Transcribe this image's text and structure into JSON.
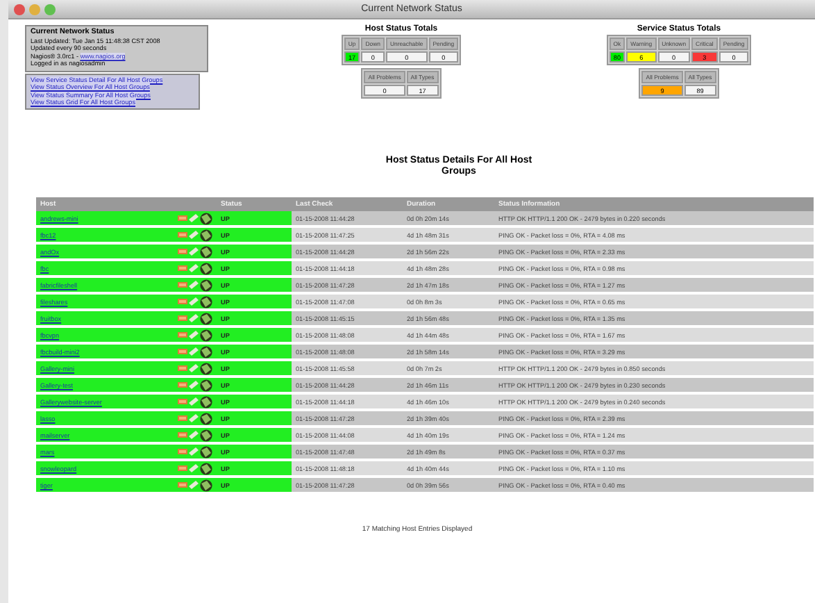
{
  "window": {
    "title": "Current Network Status"
  },
  "info": {
    "title": "Current Network Status",
    "lines": [
      "Last Updated: Tue Jan 15 11:48:38 CST 2008",
      "Updated every 90 seconds",
      "Logged in as nagiosadmin"
    ],
    "version": "Nagios® 3.0rc1 -",
    "version_link": "www.nagios.org"
  },
  "links": [
    "View Service Status Detail For All Host Groups",
    "View Status Overview For All Host Groups",
    "View Status Summary For All Host Groups",
    "View Status Grid For All Host Groups"
  ],
  "host_totals": {
    "title": "Host Status Totals",
    "main": [
      {
        "label": "Up",
        "value": "17",
        "color": "#00ee00"
      },
      {
        "label": "Down",
        "value": "0"
      },
      {
        "label": "Unreachable",
        "value": "0"
      },
      {
        "label": "Pending",
        "value": "0"
      }
    ],
    "summary": [
      {
        "label": "All Problems",
        "value": "0"
      },
      {
        "label": "All Types",
        "value": "17"
      }
    ]
  },
  "service_totals": {
    "title": "Service Status Totals",
    "main": [
      {
        "label": "Ok",
        "value": "80",
        "color": "#00ee00"
      },
      {
        "label": "Warning",
        "value": "6",
        "color": "#ffff00"
      },
      {
        "label": "Unknown",
        "value": "0"
      },
      {
        "label": "Critical",
        "value": "3",
        "color": "#f83838"
      },
      {
        "label": "Pending",
        "value": "0"
      }
    ],
    "summary": [
      {
        "label": "All Problems",
        "value": "9",
        "color": "#ffa500"
      },
      {
        "label": "All Types",
        "value": "89"
      }
    ]
  },
  "heading": "Host Status Details For All Host Groups",
  "table": {
    "columns": [
      "Host",
      "Status",
      "Last Check",
      "Duration",
      "Status Information"
    ],
    "rows": [
      {
        "host": "andrews-mini",
        "status": "UP",
        "last_check": "01-15-2008 11:44:28",
        "duration": "0d 0h 20m 14s",
        "info": "HTTP OK HTTP/1.1 200 OK - 2479 bytes in 0.220 seconds"
      },
      {
        "host": "fbc12",
        "status": "UP",
        "last_check": "01-15-2008 11:47:25",
        "duration": "4d 1h 48m 31s",
        "info": "PING OK - Packet loss = 0%, RTA = 4.08 ms"
      },
      {
        "host": "andOx",
        "status": "UP",
        "last_check": "01-15-2008 11:44:28",
        "duration": "2d 1h 56m 22s",
        "info": "PING OK - Packet loss = 0%, RTA = 2.33 ms"
      },
      {
        "host": "fbc",
        "status": "UP",
        "last_check": "01-15-2008 11:44:18",
        "duration": "4d 1h 48m 28s",
        "info": "PING OK - Packet loss = 0%, RTA = 0.98 ms"
      },
      {
        "host": "fabricfileshell",
        "status": "UP",
        "last_check": "01-15-2008 11:47:28",
        "duration": "2d 1h 47m 18s",
        "info": "PING OK - Packet loss = 0%, RTA = 1.27 ms"
      },
      {
        "host": "fileshares",
        "status": "UP",
        "last_check": "01-15-2008 11:47:08",
        "duration": "0d 0h 8m 3s",
        "info": "PING OK - Packet loss = 0%, RTA = 0.65 ms"
      },
      {
        "host": "fruitbox",
        "status": "UP",
        "last_check": "01-15-2008 11:45:15",
        "duration": "2d 1h 56m 48s",
        "info": "PING OK - Packet loss = 0%, RTA = 1.35 ms"
      },
      {
        "host": "fbcvpn",
        "status": "UP",
        "last_check": "01-15-2008 11:48:08",
        "duration": "4d 1h 44m 48s",
        "info": "PING OK - Packet loss = 0%, RTA = 1.67 ms"
      },
      {
        "host": "fbcbuild-mini2",
        "status": "UP",
        "last_check": "01-15-2008 11:48:08",
        "duration": "2d 1h 58m 14s",
        "info": "PING OK - Packet loss = 0%, RTA = 3.29 ms"
      },
      {
        "host": "Gallery-mini",
        "status": "UP",
        "last_check": "01-15-2008 11:45:58",
        "duration": "0d 0h 7m 2s",
        "info": "HTTP OK HTTP/1.1 200 OK - 2479 bytes in 0.850 seconds"
      },
      {
        "host": "Gallery-test",
        "status": "UP",
        "last_check": "01-15-2008 11:44:28",
        "duration": "2d 1h 46m 11s",
        "info": "HTTP OK HTTP/1.1 200 OK - 2479 bytes in 0.230 seconds"
      },
      {
        "host": "Gallerywebsite-server",
        "status": "UP",
        "last_check": "01-15-2008 11:44:18",
        "duration": "4d 1h 46m 10s",
        "info": "HTTP OK HTTP/1.1 200 OK - 2479 bytes in 0.240 seconds"
      },
      {
        "host": "lasso",
        "status": "UP",
        "last_check": "01-15-2008 11:47:28",
        "duration": "2d 1h 39m 40s",
        "info": "PING OK - Packet loss = 0%, RTA = 2.39 ms"
      },
      {
        "host": "mailserver",
        "status": "UP",
        "last_check": "01-15-2008 11:44:08",
        "duration": "4d 1h 40m 19s",
        "info": "PING OK - Packet loss = 0%, RTA = 1.24 ms"
      },
      {
        "host": "mars",
        "status": "UP",
        "last_check": "01-15-2008 11:47:48",
        "duration": "2d 1h 49m 8s",
        "info": "PING OK - Packet loss = 0%, RTA = 0.37 ms"
      },
      {
        "host": "snowleopard",
        "status": "UP",
        "last_check": "01-15-2008 11:48:18",
        "duration": "4d 1h 40m 44s",
        "info": "PING OK - Packet loss = 0%, RTA = 1.10 ms"
      },
      {
        "host": "tiger",
        "status": "UP",
        "last_check": "01-15-2008 11:47:28",
        "duration": "0d 0h 39m 56s",
        "info": "PING OK - Packet loss = 0%, RTA = 0.40 ms"
      }
    ]
  },
  "footer": "17 Matching Host Entries Displayed"
}
